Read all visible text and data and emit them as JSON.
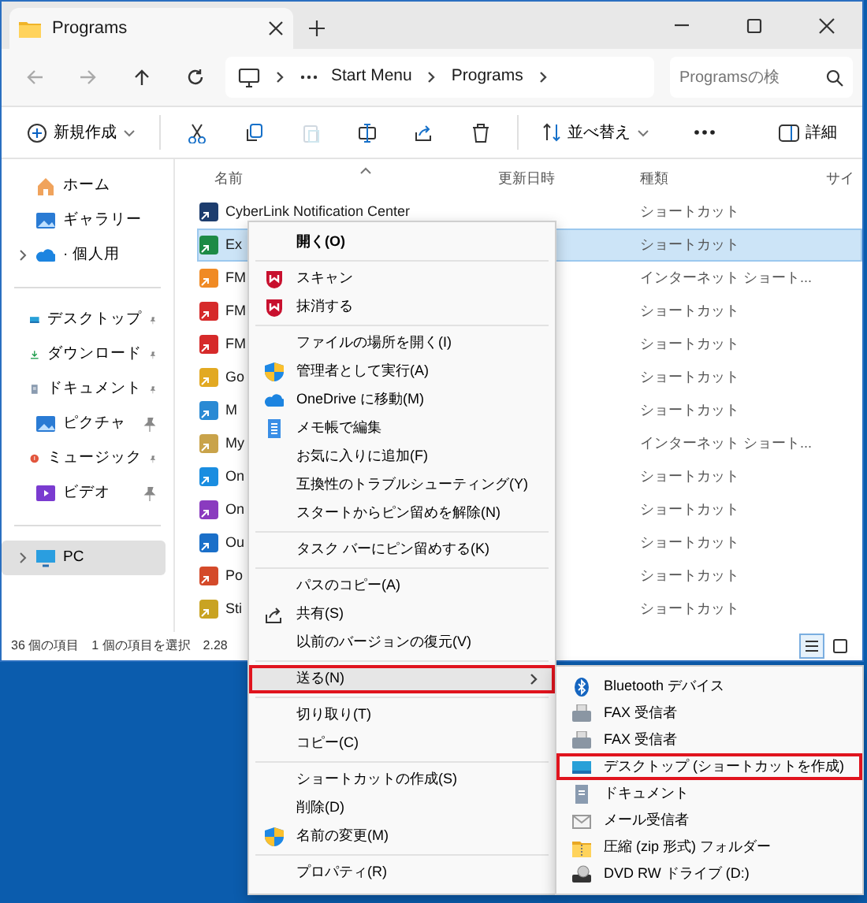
{
  "window": {
    "tab_title": "Programs"
  },
  "address_bar": {
    "crumbs": [
      "Start Menu",
      "Programs"
    ]
  },
  "search": {
    "placeholder": "Programsの検"
  },
  "toolbar": {
    "new_label": "新規作成",
    "sort_label": "並べ替え",
    "details_label": "詳細",
    "actions": [
      {
        "disabled": false
      },
      {
        "disabled": false
      },
      {
        "disabled": true
      },
      {
        "disabled": false
      },
      {
        "disabled": false
      },
      {
        "disabled": false
      }
    ]
  },
  "sidebar": {
    "groups": [
      [
        {
          "label": "ホーム",
          "pinned": false,
          "expandable": false,
          "selected": false
        },
        {
          "label": "ギャラリー",
          "pinned": false,
          "expandable": false,
          "selected": false
        },
        {
          "label": "· 個人用",
          "pinned": false,
          "expandable": true,
          "selected": false
        }
      ],
      [
        {
          "label": "デスクトップ",
          "pinned": true,
          "expandable": false,
          "selected": false
        },
        {
          "label": "ダウンロード",
          "pinned": true,
          "expandable": false,
          "selected": false
        },
        {
          "label": "ドキュメント",
          "pinned": true,
          "expandable": false,
          "selected": false
        },
        {
          "label": "ピクチャ",
          "pinned": true,
          "expandable": false,
          "selected": false
        },
        {
          "label": "ミュージック",
          "pinned": true,
          "expandable": false,
          "selected": false
        },
        {
          "label": "ビデオ",
          "pinned": true,
          "expandable": false,
          "selected": false
        }
      ],
      [
        {
          "label": "PC",
          "pinned": false,
          "expandable": true,
          "selected": true
        }
      ]
    ]
  },
  "file_list": {
    "columns": [
      {
        "label": "名前",
        "sorted": true
      },
      {
        "label": "更新日時",
        "sorted": false
      },
      {
        "label": "種類",
        "sorted": false
      },
      {
        "label": "サイ",
        "sorted": false
      }
    ],
    "rows": [
      {
        "name": "CyberLink Notification Center",
        "type": "ショートカット",
        "selected": false
      },
      {
        "name": "Ex",
        "type": "ショートカット",
        "selected": true
      },
      {
        "name": "FM",
        "type": "インターネット ショート...",
        "selected": false
      },
      {
        "name": "FM",
        "type": "ショートカット",
        "selected": false
      },
      {
        "name": "FM",
        "type": "ショートカット",
        "selected": false
      },
      {
        "name": "Go",
        "type": "ショートカット",
        "selected": false
      },
      {
        "name": "M",
        "type": "ショートカット",
        "selected": false
      },
      {
        "name": "My",
        "type": "インターネット ショート...",
        "selected": false
      },
      {
        "name": "On",
        "type": "ショートカット",
        "selected": false
      },
      {
        "name": "On",
        "type": "ショートカット",
        "selected": false
      },
      {
        "name": "Ou",
        "type": "ショートカット",
        "selected": false
      },
      {
        "name": "Po",
        "type": "ショートカット",
        "selected": false
      },
      {
        "name": "Sti",
        "type": "ショートカット",
        "selected": false
      }
    ]
  },
  "status_bar": {
    "item_count": "36 個の項目",
    "selection": "1 個の項目を選択",
    "size": "2.28",
    "views": [
      {
        "selected": true
      },
      {
        "selected": false
      }
    ]
  },
  "context_menu": {
    "groups": [
      [
        {
          "label": "開く(O)",
          "bold": true
        }
      ],
      [
        {
          "label": "スキャン"
        },
        {
          "label": "抹消する"
        }
      ],
      [
        {
          "label": "ファイルの場所を開く(I)"
        },
        {
          "label": "管理者として実行(A)"
        },
        {
          "label": "OneDrive に移動(M)"
        },
        {
          "label": "メモ帳で編集"
        },
        {
          "label": "お気に入りに追加(F)"
        },
        {
          "label": "互換性のトラブルシューティング(Y)"
        },
        {
          "label": "スタートからピン留めを解除(N)"
        }
      ],
      [
        {
          "label": "タスク バーにピン留めする(K)"
        }
      ],
      [
        {
          "label": "パスのコピー(A)"
        },
        {
          "label": "共有(S)"
        },
        {
          "label": "以前のバージョンの復元(V)"
        }
      ],
      [
        {
          "label": "送る(N)",
          "hovered": true,
          "outlined": true,
          "submenu": true
        }
      ],
      [
        {
          "label": "切り取り(T)"
        },
        {
          "label": "コピー(C)"
        }
      ],
      [
        {
          "label": "ショートカットの作成(S)"
        },
        {
          "label": "削除(D)"
        },
        {
          "label": "名前の変更(M)"
        }
      ],
      [
        {
          "label": "プロパティ(R)"
        }
      ]
    ]
  },
  "send_to_menu": {
    "items": [
      {
        "label": "Bluetooth デバイス",
        "outlined": false
      },
      {
        "label": "FAX 受信者",
        "outlined": false
      },
      {
        "label": "FAX 受信者",
        "outlined": false
      },
      {
        "label": "デスクトップ (ショートカットを作成)",
        "outlined": true
      },
      {
        "label": "ドキュメント",
        "outlined": false
      },
      {
        "label": "メール受信者",
        "outlined": false
      },
      {
        "label": "圧縮 (zip 形式) フォルダー",
        "outlined": false
      },
      {
        "label": "DVD RW ドライブ (D:)",
        "outlined": false
      }
    ]
  }
}
